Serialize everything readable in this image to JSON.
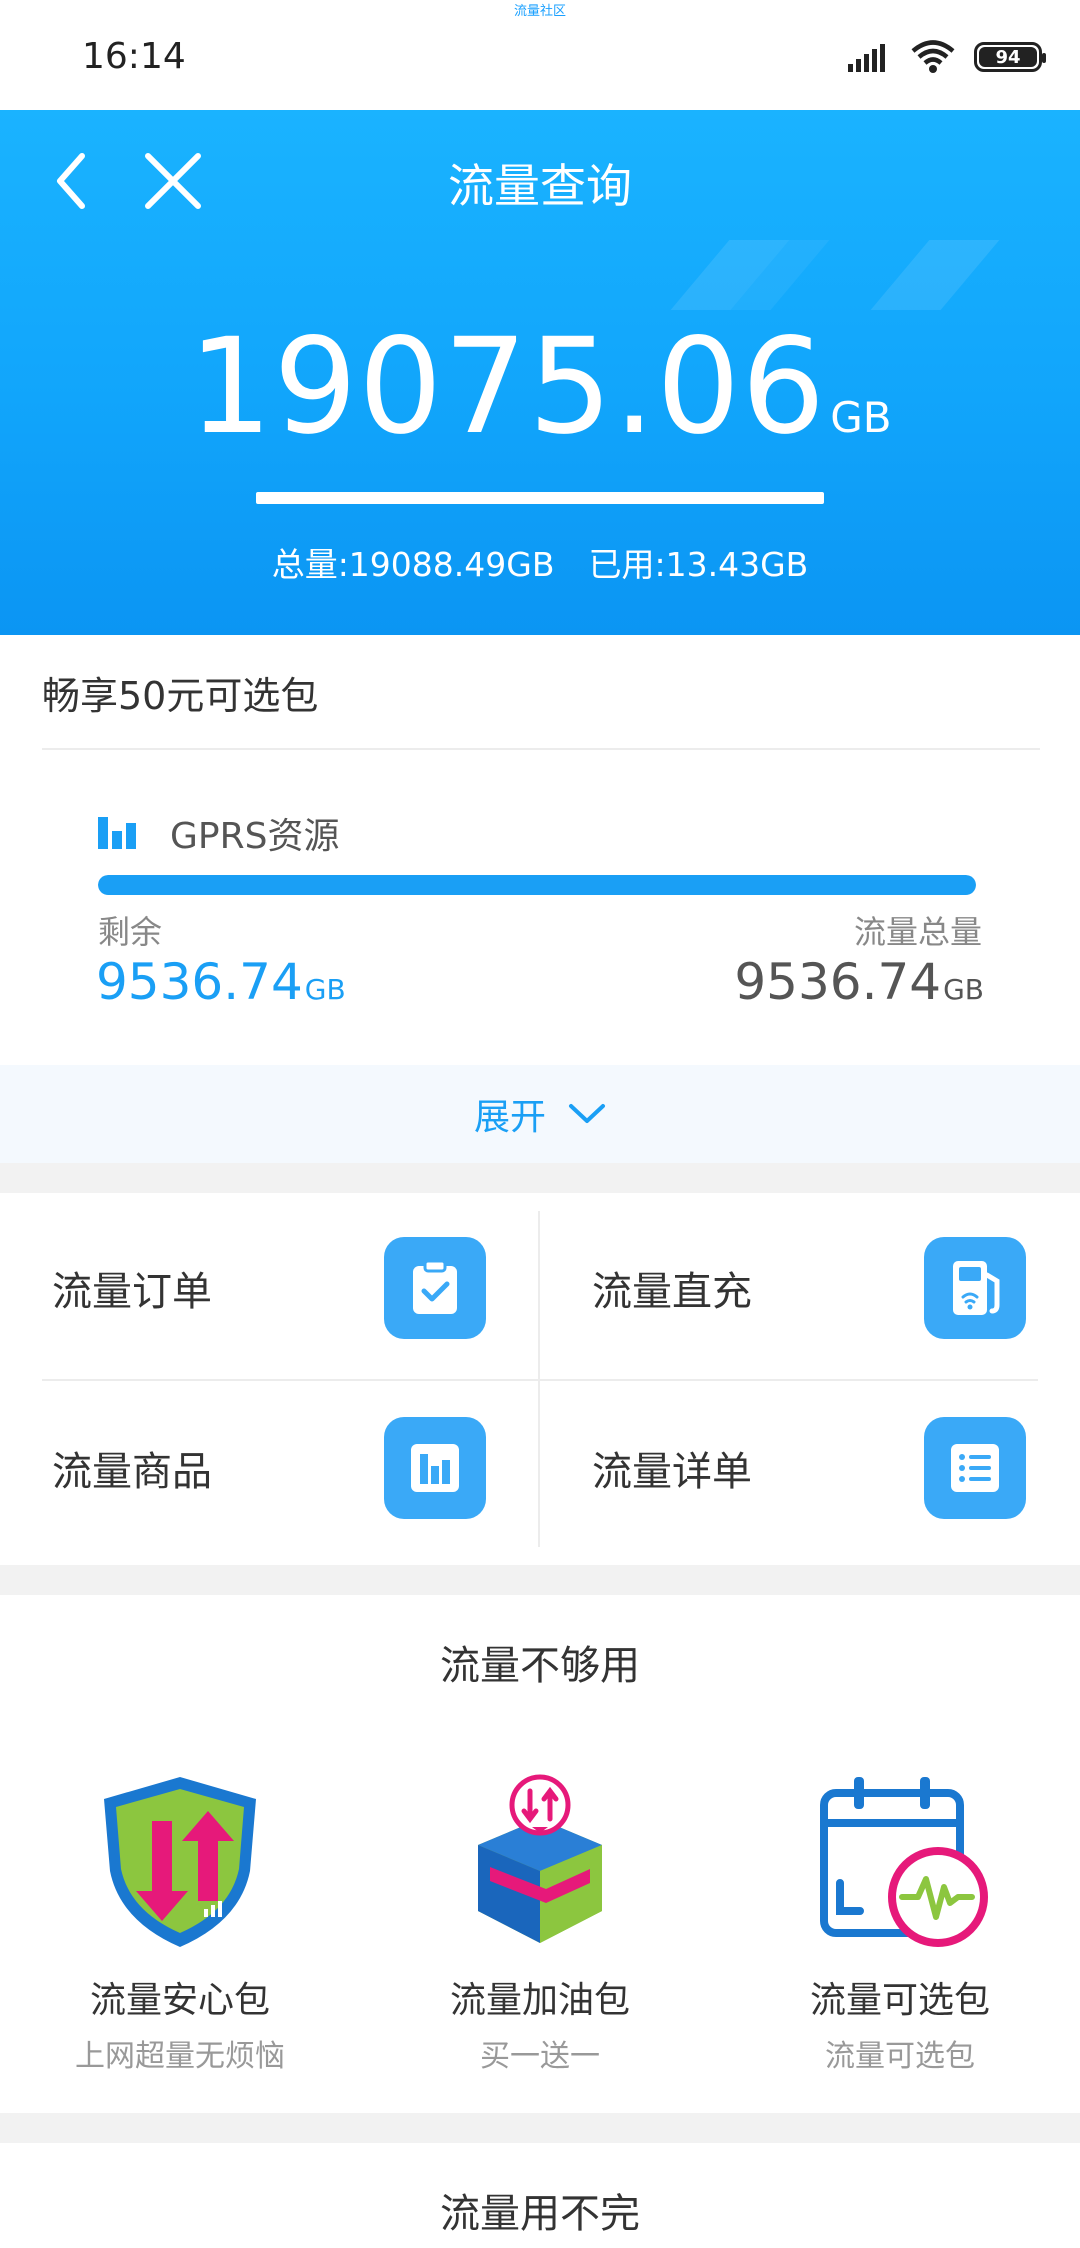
{
  "status_bar": {
    "top_text": "流量社区",
    "time": "16:14",
    "battery": "94"
  },
  "header": {
    "title": "流量查询",
    "amount": "19075.06",
    "amount_unit": "GB",
    "total_text": "总量:19088.49GB",
    "used_text": "已用:13.43GB",
    "colors": {
      "primary": "#11a5fb"
    }
  },
  "package": {
    "title": "畅享50元可选包",
    "resource_label": "GPRS资源",
    "remaining_fraction": 1.0,
    "remain_label": "剩余",
    "remain_value": "9536.74",
    "remain_unit": "GB",
    "total_label": "流量总量",
    "total_value": "9536.74",
    "total_unit": "GB",
    "expand_label": "展开"
  },
  "menu": {
    "items": [
      {
        "label": "流量订单",
        "icon": "clipboard-check-icon"
      },
      {
        "label": "流量直充",
        "icon": "fuel-pump-icon"
      },
      {
        "label": "流量商品",
        "icon": "bar-chart-icon"
      },
      {
        "label": "流量详单",
        "icon": "list-icon"
      }
    ]
  },
  "not_enough": {
    "title": "流量不够用",
    "items": [
      {
        "name": "流量安心包",
        "desc": "上网超量无烦恼",
        "icon": "shield-arrows-icon"
      },
      {
        "name": "流量加油包",
        "desc": "买一送一",
        "icon": "box-package-icon"
      },
      {
        "name": "流量可选包",
        "desc": "流量可选包",
        "icon": "calendar-signal-icon"
      }
    ]
  },
  "leftover": {
    "title": "流量用不完"
  }
}
